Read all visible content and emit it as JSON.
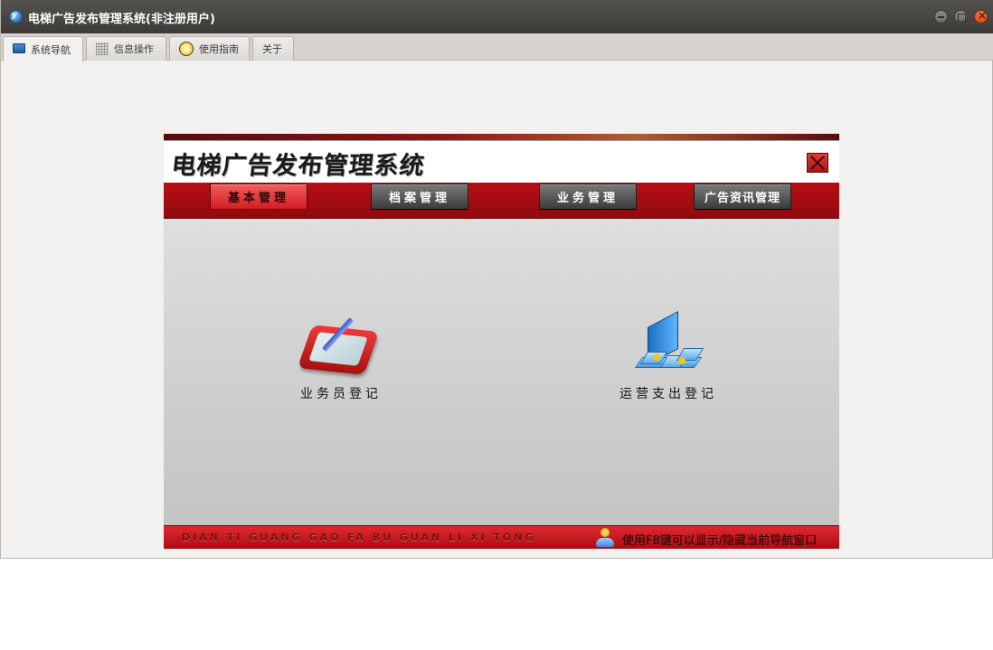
{
  "window": {
    "title": "电梯广告发布管理系统(非注册用户)",
    "logo_text": "y"
  },
  "tabs": [
    {
      "label": "系统导航",
      "icon": "monitor-icon",
      "active": true
    },
    {
      "label": "信息操作",
      "icon": "grid-icon",
      "active": false
    },
    {
      "label": "使用指南",
      "icon": "clock-icon",
      "active": false
    },
    {
      "label": "关于",
      "icon": "",
      "active": false
    }
  ],
  "panel": {
    "system_title": "电梯广告发布管理系统",
    "menu": [
      {
        "label": "基本管理",
        "active": true
      },
      {
        "label": "档案管理",
        "active": false
      },
      {
        "label": "业务管理",
        "active": false
      },
      {
        "label": "广告资讯管理",
        "active": false
      }
    ],
    "features": [
      {
        "label": "业务员登记",
        "icon": "tablet-pen-icon"
      },
      {
        "label": "运营支出登记",
        "icon": "monitor-documents-icon"
      }
    ],
    "footer_pinyin": "DIAN TI GUANG GAO FA BU GUAN LI XI TONG",
    "footer_hint": "使用F8键可以显示/隐藏当前导航窗口"
  },
  "colors": {
    "accent_red": "#b80f15",
    "titlebar": "#3c3b37"
  }
}
